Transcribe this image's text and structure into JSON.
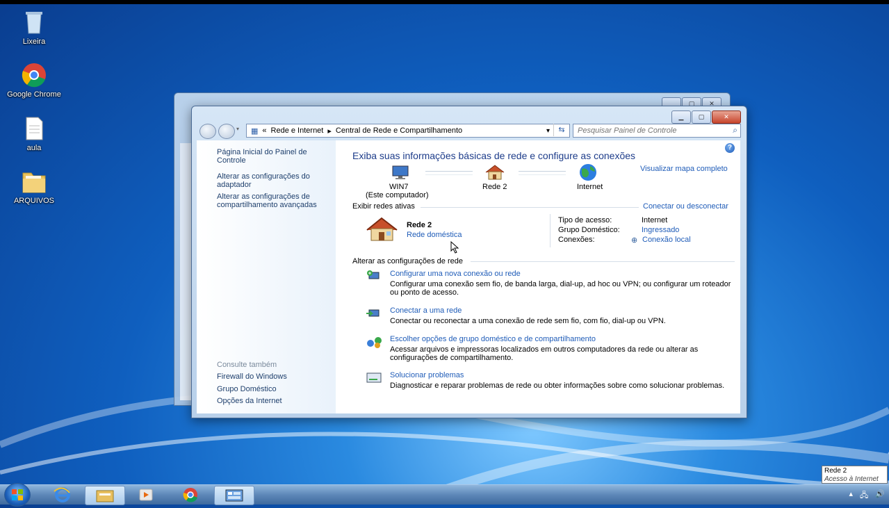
{
  "desktop": {
    "icons": [
      {
        "label": "Lixeira",
        "icon": "recycle-bin-icon"
      },
      {
        "label": "Google Chrome",
        "icon": "chrome-icon"
      },
      {
        "label": "aula",
        "icon": "text-file-icon"
      },
      {
        "label": "ARQUIVOS",
        "icon": "folder-icon"
      }
    ]
  },
  "window": {
    "breadcrumb": {
      "overflow": "«",
      "segments": [
        "Rede e Internet",
        "Central de Rede e Compartilhamento"
      ],
      "separator": "▸"
    },
    "search_placeholder": "Pesquisar Painel de Controle",
    "left_pane": {
      "links": [
        "Página Inicial do Painel de Controle",
        "Alterar as configurações do adaptador",
        "Alterar as configurações de compartilhamento avançadas"
      ],
      "see_also_heading": "Consulte também",
      "see_also": [
        "Firewall do Windows",
        "Grupo Doméstico",
        "Opções da Internet"
      ]
    },
    "main": {
      "heading": "Exiba suas informações básicas de rede e configure as conexões",
      "full_map_link": "Visualizar mapa completo",
      "map": [
        {
          "label": "WIN7",
          "sub": "(Este computador)",
          "icon": "computer-icon"
        },
        {
          "label": "Rede  2",
          "icon": "house-icon"
        },
        {
          "label": "Internet",
          "icon": "globe-icon"
        }
      ],
      "active_section": "Exibir redes ativas",
      "connect_link": "Conectar ou desconectar",
      "network_name": "Rede  2",
      "network_type": "Rede doméstica",
      "props": [
        {
          "key": "Tipo de acesso:",
          "value": "Internet",
          "is_link": false
        },
        {
          "key": "Grupo Doméstico:",
          "value": "Ingressado",
          "is_link": true
        },
        {
          "key": "Conexões:",
          "value": "Conexão local",
          "is_link": true
        }
      ],
      "change_section": "Alterar as configurações de rede",
      "tasks": [
        {
          "title": "Configurar uma nova conexão ou rede",
          "desc": "Configurar uma conexão sem fio, de banda larga, dial-up, ad hoc ou VPN; ou configurar um roteador ou ponto de acesso."
        },
        {
          "title": "Conectar a uma rede",
          "desc": "Conectar ou reconectar a uma conexão de rede sem fio, com fio, dial-up ou VPN."
        },
        {
          "title": "Escolher opções de grupo doméstico e de compartilhamento",
          "desc": "Acessar arquivos e impressoras localizados em outros computadores da rede ou alterar as configurações de compartilhamento."
        },
        {
          "title": "Solucionar problemas",
          "desc": "Diagnosticar e reparar problemas de rede ou obter informações sobre como solucionar problemas."
        }
      ]
    }
  },
  "taskbar": {
    "items": [
      "internet-explorer-icon",
      "explorer-icon",
      "media-player-icon",
      "chrome-icon",
      "control-panel-icon"
    ],
    "tooltip": {
      "title": "Rede  2",
      "subtitle": "Acesso à Internet"
    }
  }
}
